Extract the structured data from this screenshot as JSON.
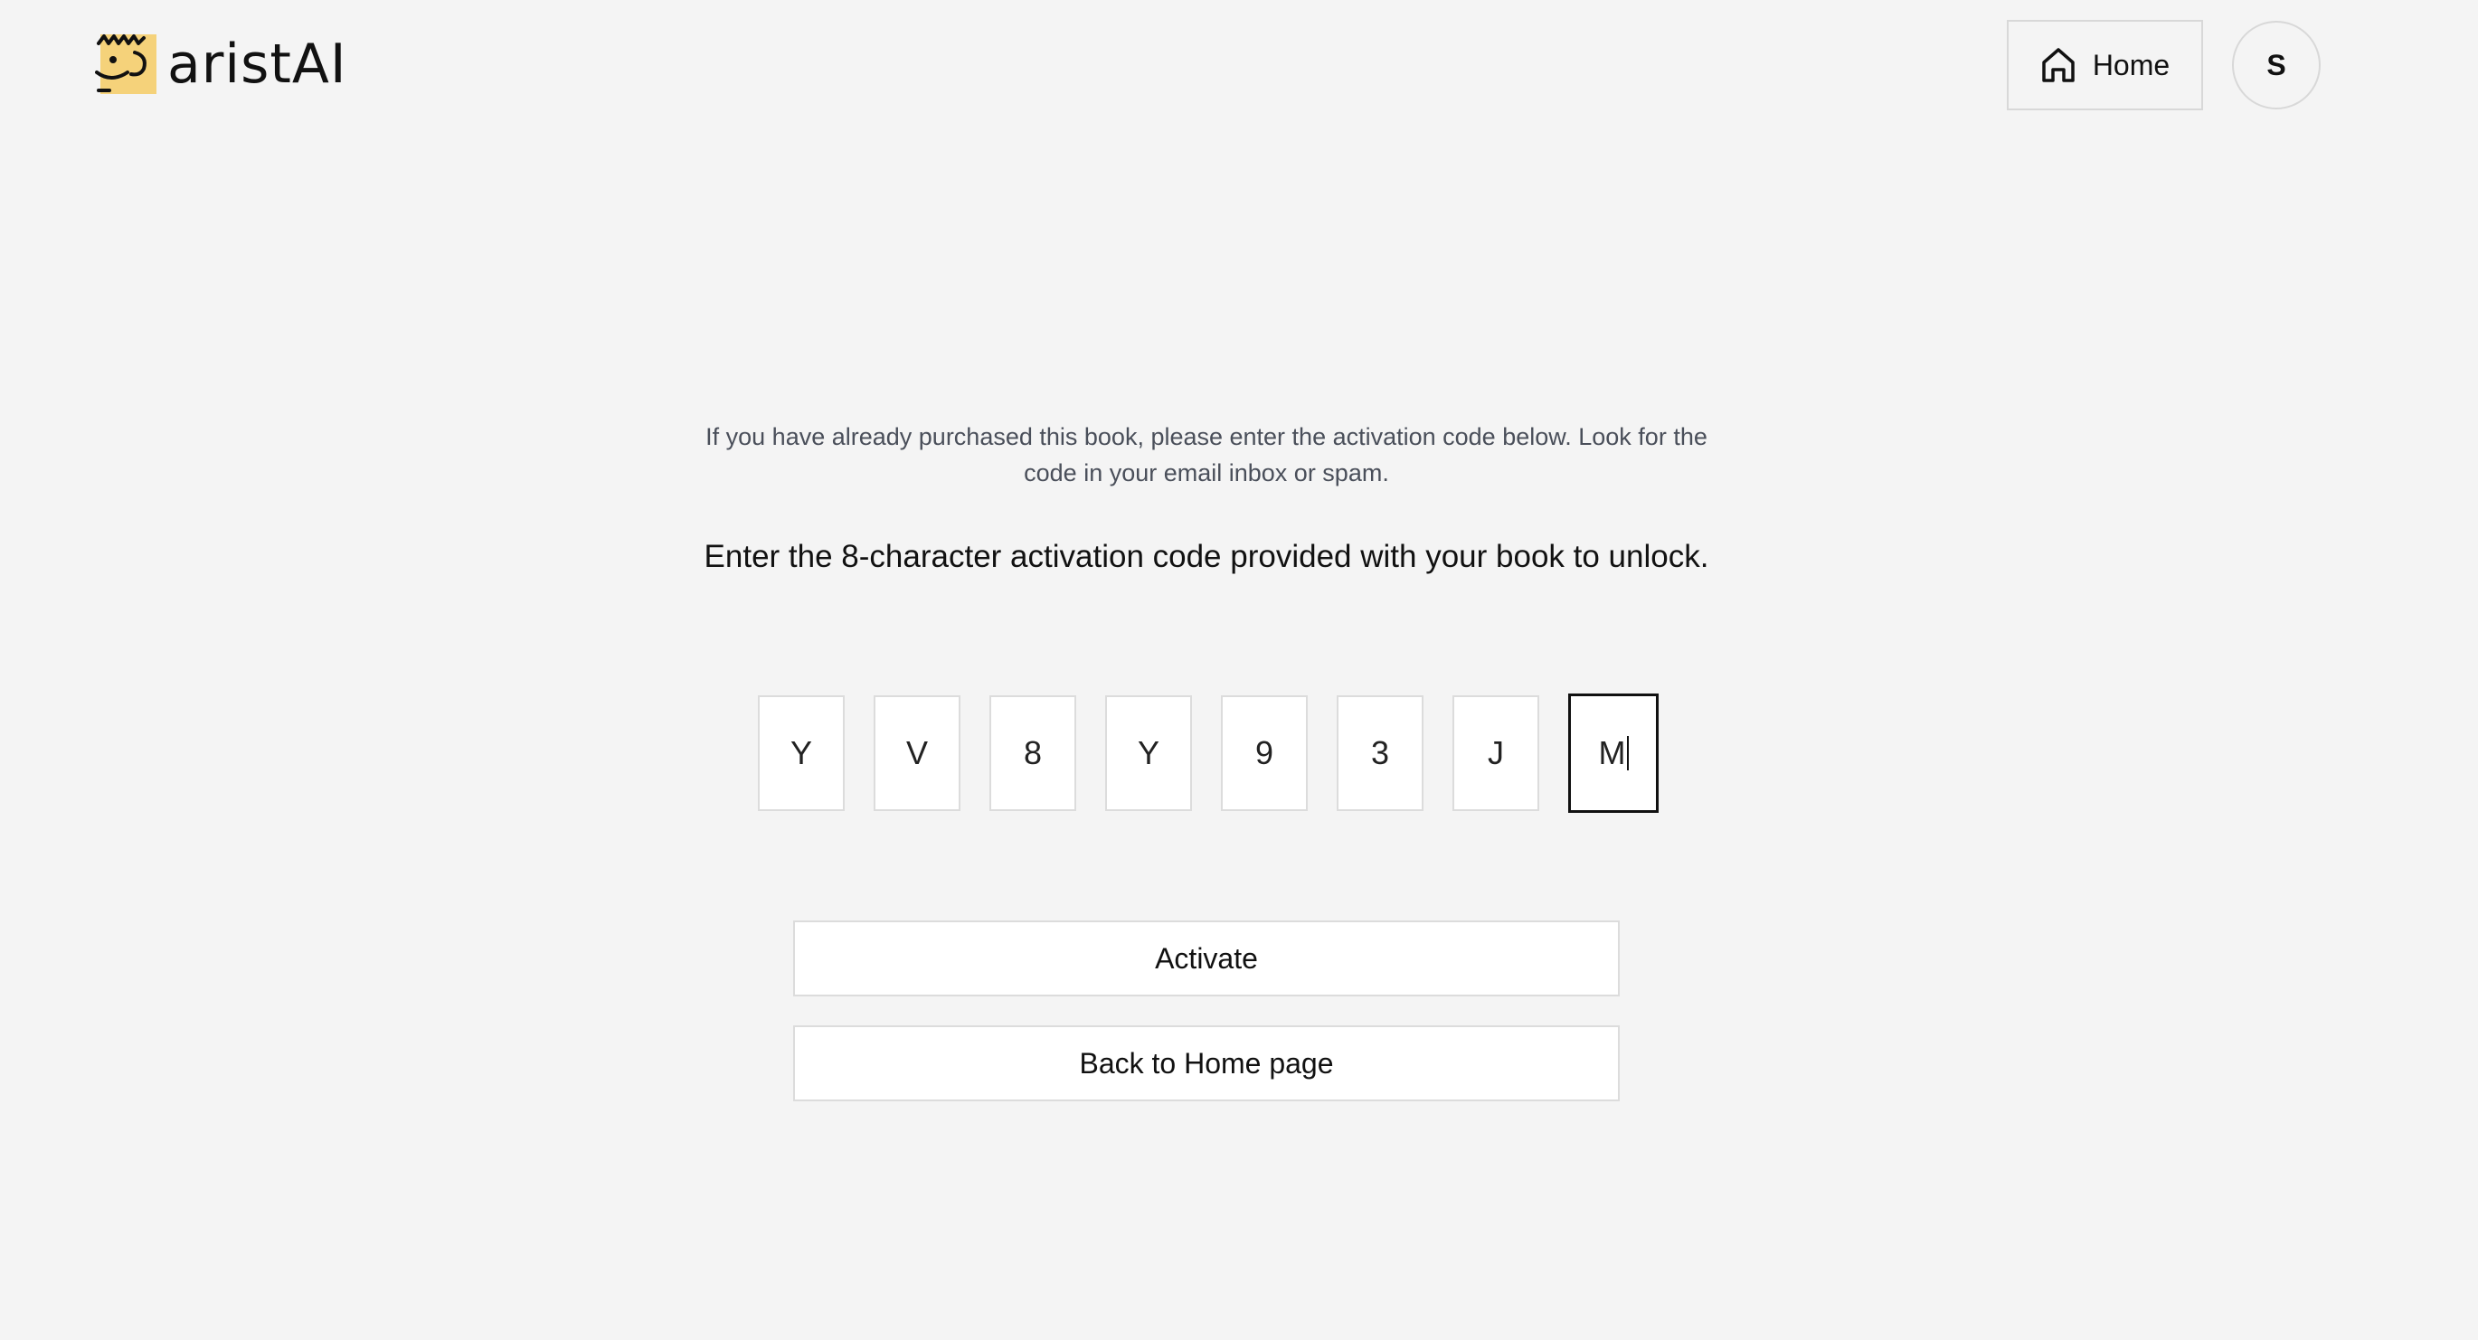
{
  "header": {
    "brand": "aristAI",
    "home_label": "Home",
    "avatar_initial": "S"
  },
  "main": {
    "intro_text": "If you have already purchased this book, please enter the activation code below. Look for the code in your email inbox or spam.",
    "instruction": "Enter the 8-character activation code provided with your book to unlock.",
    "code": [
      "Y",
      "V",
      "8",
      "Y",
      "9",
      "3",
      "J",
      "M"
    ],
    "activate_label": "Activate",
    "back_label": "Back to Home page"
  },
  "colors": {
    "background": "#f4f4f4",
    "logo_accent": "#f5d27a",
    "border": "#dcdcdc",
    "text_muted": "#4a4f5a"
  },
  "icons": {
    "logo": "cartoon-face-logo-icon",
    "home": "house-icon"
  }
}
